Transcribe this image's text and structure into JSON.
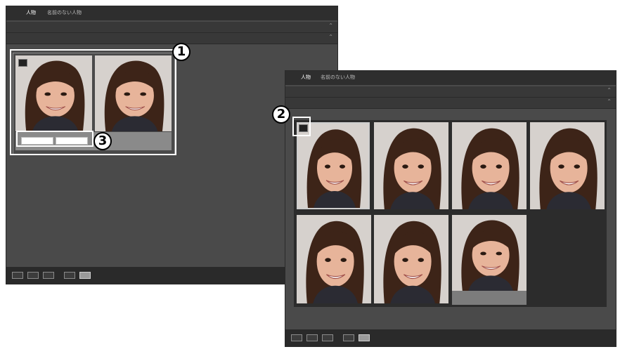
{
  "callouts": [
    "1",
    "2",
    "3"
  ],
  "left_panel": {
    "tabs": [
      "人物",
      "名前のない人物"
    ],
    "rows": [
      "",
      ""
    ],
    "thumbnails": 2
  },
  "right_panel": {
    "tabs": [
      "人物",
      "名前のない人物"
    ],
    "rows": [
      "",
      ""
    ],
    "thumbnails": 7
  },
  "icons": [
    "view-mode-icon",
    "selection-check-icon",
    "chevron-icon"
  ],
  "colors": {
    "panel_bg": "#4a4a4a",
    "tab_bar": "#2e2e2e",
    "bottom_bar": "#2a2a2a",
    "highlight": "#ffffff"
  }
}
